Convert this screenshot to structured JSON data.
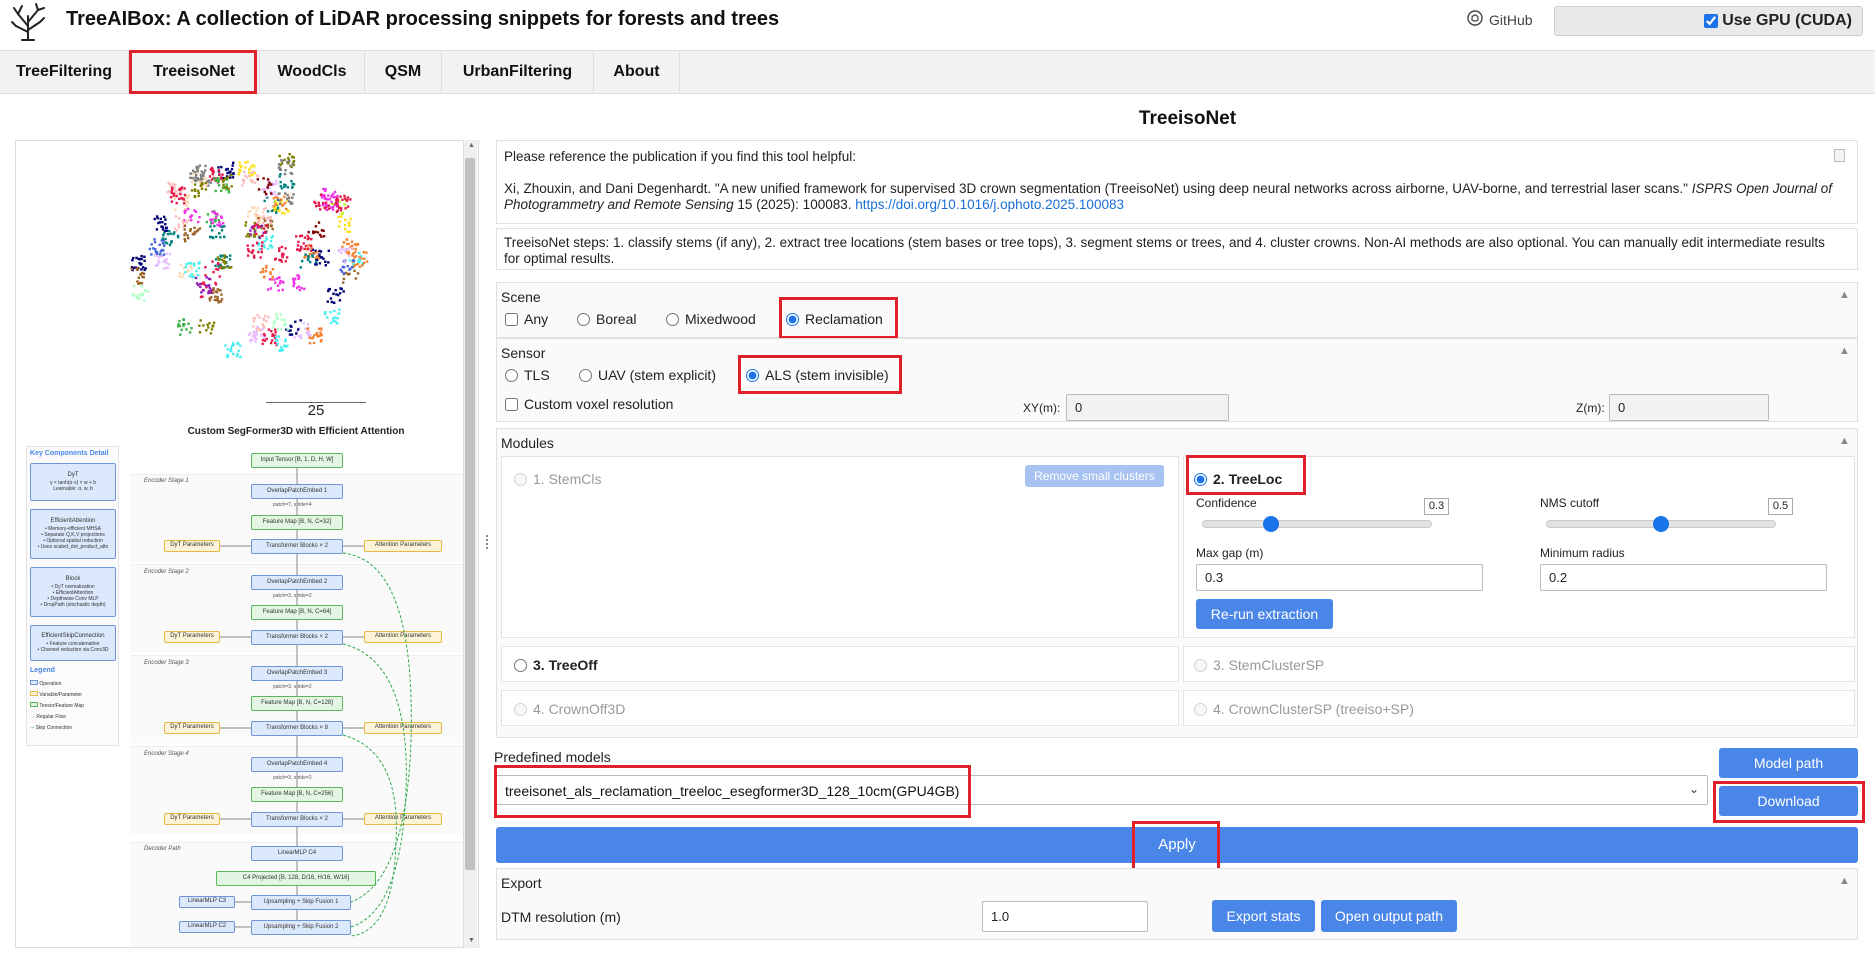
{
  "app": {
    "title": "TreeAIBox: A collection of LiDAR processing snippets for forests and trees",
    "github_label": "GitHub",
    "gpu_label": "Use GPU (CUDA)",
    "gpu_checked": true
  },
  "tabs": [
    {
      "label": "TreeFiltering",
      "active": false
    },
    {
      "label": "TreeisoNet",
      "active": true
    },
    {
      "label": "WoodCls",
      "active": false
    },
    {
      "label": "QSM",
      "active": false
    },
    {
      "label": "UrbanFiltering",
      "active": false
    },
    {
      "label": "About",
      "active": false
    }
  ],
  "page_title": "TreeisoNet",
  "diagram": {
    "counter": "25",
    "title": "Custom SegFormer3D with Efficient Attention",
    "key_title": "Key Components Detail",
    "key_items": [
      {
        "title": "DyT",
        "lines": "γ × tanh(α·x) × w + b\nLearnable: α, w, b"
      },
      {
        "title": "EfficientAttention",
        "lines": "• Memory-efficient MHSA\n• Separate Q,K,V projections\n• Optional spatial reduction\n• Uses scaled_dot_product_attn"
      },
      {
        "title": "Block",
        "lines": "• DyT normalization\n• EfficientAttention\n• Depthwise Conv MLP\n• DropPath (stochastic depth)"
      },
      {
        "title": "EfficientSkipConnection",
        "lines": "• Feature concatenation\n• Channel reduction via Conv3D"
      }
    ],
    "legend_title": "Legend",
    "legend_items": [
      "Operation",
      "Variable/Parameter",
      "Tensor/Feature Map",
      "Regular Flow",
      "Skip Connection"
    ],
    "input_label": "Input Tensor [B, 1, D, H, W]",
    "stages": [
      {
        "label": "Encoder Stage 1",
        "embed": "OverlapPatchEmbed 1",
        "stride": "patch=7, stride=4",
        "feature": "Feature Map [B, N, C=32]",
        "blocks": "Transformer Blocks × 2"
      },
      {
        "label": "Encoder Stage 2",
        "embed": "OverlapPatchEmbed 2",
        "stride": "patch=3, stride=2",
        "feature": "Feature Map [B, N, C=64]",
        "blocks": "Transformer Blocks × 2"
      },
      {
        "label": "Encoder Stage 3",
        "embed": "OverlapPatchEmbed 3",
        "stride": "patch=3, stride=2",
        "feature": "Feature Map [B, N, C=128]",
        "blocks": "Transformer Blocks × 8"
      },
      {
        "label": "Encoder Stage 4",
        "embed": "OverlapPatchEmbed 4",
        "stride": "patch=3, stride=2",
        "feature": "Feature Map [B, N, C=256]",
        "blocks": "Transformer Blocks × 2"
      }
    ],
    "dyt_params": "DyT Parameters",
    "attn_params": "Attention Parameters",
    "decoder_label": "Decoder Path",
    "linear_c4": "LinearMLP C4",
    "c4_projected": "C4 Projected [B, 128, D/16, H/16, W/16]",
    "linear_c3": "LinearMLP C3",
    "linear_c2": "LinearMLP C2",
    "up1": "Upsampling + Skip Fusion 1",
    "up2": "Upsampling + Skip Fusion 2"
  },
  "reference": {
    "intro": "Please reference the publication if you find this tool helpful:",
    "citation": "Xi, Zhouxin, and Dani Degenhardt. \"A new unified framework for supervised 3D crown segmentation (TreeisoNet) using deep neural networks across airborne, UAV-borne, and terrestrial laser scans.\"",
    "journal": "ISPRS Open Journal of Photogrammetry and Remote Sensing",
    "volume": "15 (2025): 100083.",
    "doi": "https://doi.org/10.1016/j.ophoto.2025.100083"
  },
  "steps_text": "TreeisoNet steps: 1. classify stems (if any), 2. extract tree locations (stem bases or tree tops), 3. segment stems or trees, and 4. cluster crowns. Non-AI methods are also optional. You can manually edit intermediate results for optimal results.",
  "scene": {
    "title": "Scene",
    "options": [
      {
        "label": "Any",
        "type": "checkbox",
        "checked": false
      },
      {
        "label": "Boreal",
        "type": "radio",
        "checked": false
      },
      {
        "label": "Mixedwood",
        "type": "radio",
        "checked": false
      },
      {
        "label": "Reclamation",
        "type": "radio",
        "checked": true
      }
    ]
  },
  "sensor": {
    "title": "Sensor",
    "options": [
      {
        "label": "TLS",
        "checked": false
      },
      {
        "label": "UAV (stem explicit)",
        "checked": false
      },
      {
        "label": "ALS (stem invisible)",
        "checked": true
      }
    ],
    "custom_voxel_label": "Custom voxel resolution",
    "xy_label": "XY(m):",
    "xy_value": "0",
    "z_label": "Z(m):",
    "z_value": "0"
  },
  "modules": {
    "title": "Modules",
    "stemcls": "1. StemCls",
    "remove_small": "Remove small clusters",
    "treeloc": "2. TreeLoc",
    "confidence_label": "Confidence",
    "confidence_value": "0.3",
    "confidence_fraction": 0.3,
    "nms_label": "NMS cutoff",
    "nms_value": "0.5",
    "nms_fraction": 0.5,
    "max_gap_label": "Max gap (m)",
    "max_gap_value": "0.3",
    "min_radius_label": "Minimum radius",
    "min_radius_value": "0.2",
    "rerun_label": "Re-run extraction",
    "treeoff": "3. TreeOff",
    "stemclustersp": "3. StemClusterSP",
    "crownoff3d": "4. CrownOff3D",
    "crownclustersp": "4. CrownClusterSP (treeiso+SP)"
  },
  "models": {
    "label": "Predefined models",
    "selected": "treeisonet_als_reclamation_treeloc_esegformer3D_128_10cm(GPU4GB)",
    "model_path_label": "Model path",
    "download_label": "Download",
    "apply_label": "Apply"
  },
  "export": {
    "title": "Export",
    "dtm_label": "DTM resolution (m)",
    "dtm_value": "1.0",
    "export_stats_label": "Export stats",
    "open_output_label": "Open output path"
  },
  "colors": {
    "accent": "#4a86e8",
    "highlight": "#e0202a"
  }
}
